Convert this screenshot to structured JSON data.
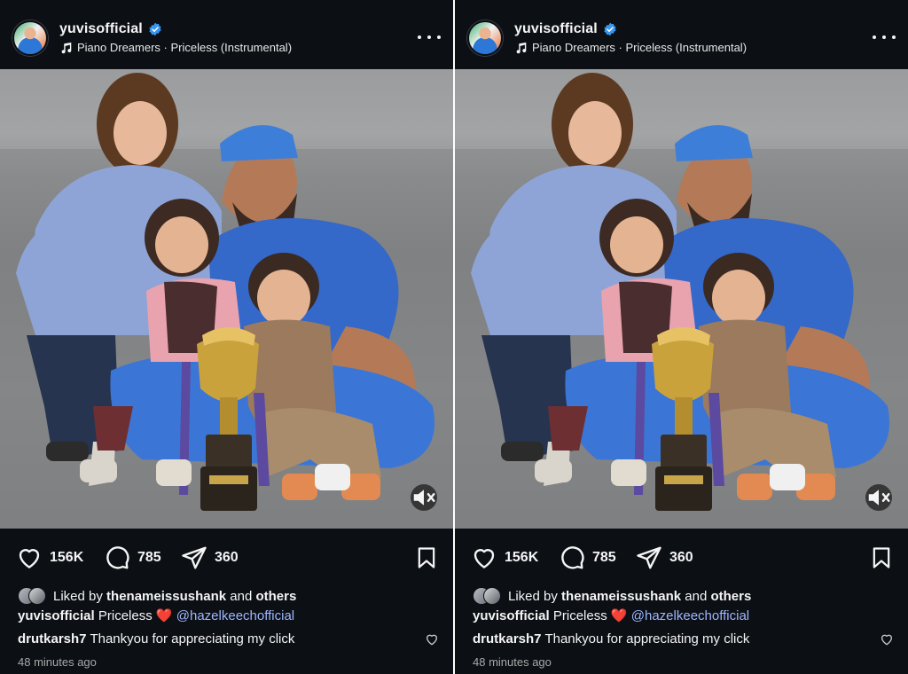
{
  "posts": [
    {
      "header": {
        "username": "yuvisofficial",
        "audio": "Piano Dreamers · Priceless (Instrumental)"
      },
      "actions": {
        "likes": "156K",
        "comments": "785",
        "shares": "360"
      },
      "liked_by": {
        "prefix": "Liked by",
        "user": "thenameissushank",
        "joiner": "and",
        "others": "others"
      },
      "caption": {
        "user": "yuvisofficial",
        "text": "Priceless",
        "emoji": "❤️",
        "mention": "@hazelkeechofficial"
      },
      "comment": {
        "user": "drutkarsh7",
        "text": "Thankyou for appreciating my click"
      },
      "time": "48 minutes ago"
    },
    {
      "header": {
        "username": "yuvisofficial",
        "audio": "Piano Dreamers · Priceless (Instrumental)"
      },
      "actions": {
        "likes": "156K",
        "comments": "785",
        "shares": "360"
      },
      "liked_by": {
        "prefix": "Liked by",
        "user": "thenameissushank",
        "joiner": "and",
        "others": "others"
      },
      "caption": {
        "user": "yuvisofficial",
        "text": "Priceless",
        "emoji": "❤️",
        "mention": "@hazelkeechofficial"
      },
      "comment": {
        "user": "drutkarsh7",
        "text": "Thankyou for appreciating my click"
      },
      "time": "48 minutes ago"
    }
  ],
  "icons": {
    "verified": "verified-badge-icon",
    "audio": "music-note-icon",
    "more": "more-horizontal-icon",
    "like": "heart-icon",
    "comment": "comment-bubble-icon",
    "share": "paper-plane-icon",
    "save": "bookmark-icon",
    "mute": "speaker-muted-icon"
  },
  "colors": {
    "background": "#0c0f14",
    "text": "#f5f5f5",
    "verified": "#3897f0",
    "mention": "#9eb7ff",
    "muted_text": "#a8a8a8"
  }
}
